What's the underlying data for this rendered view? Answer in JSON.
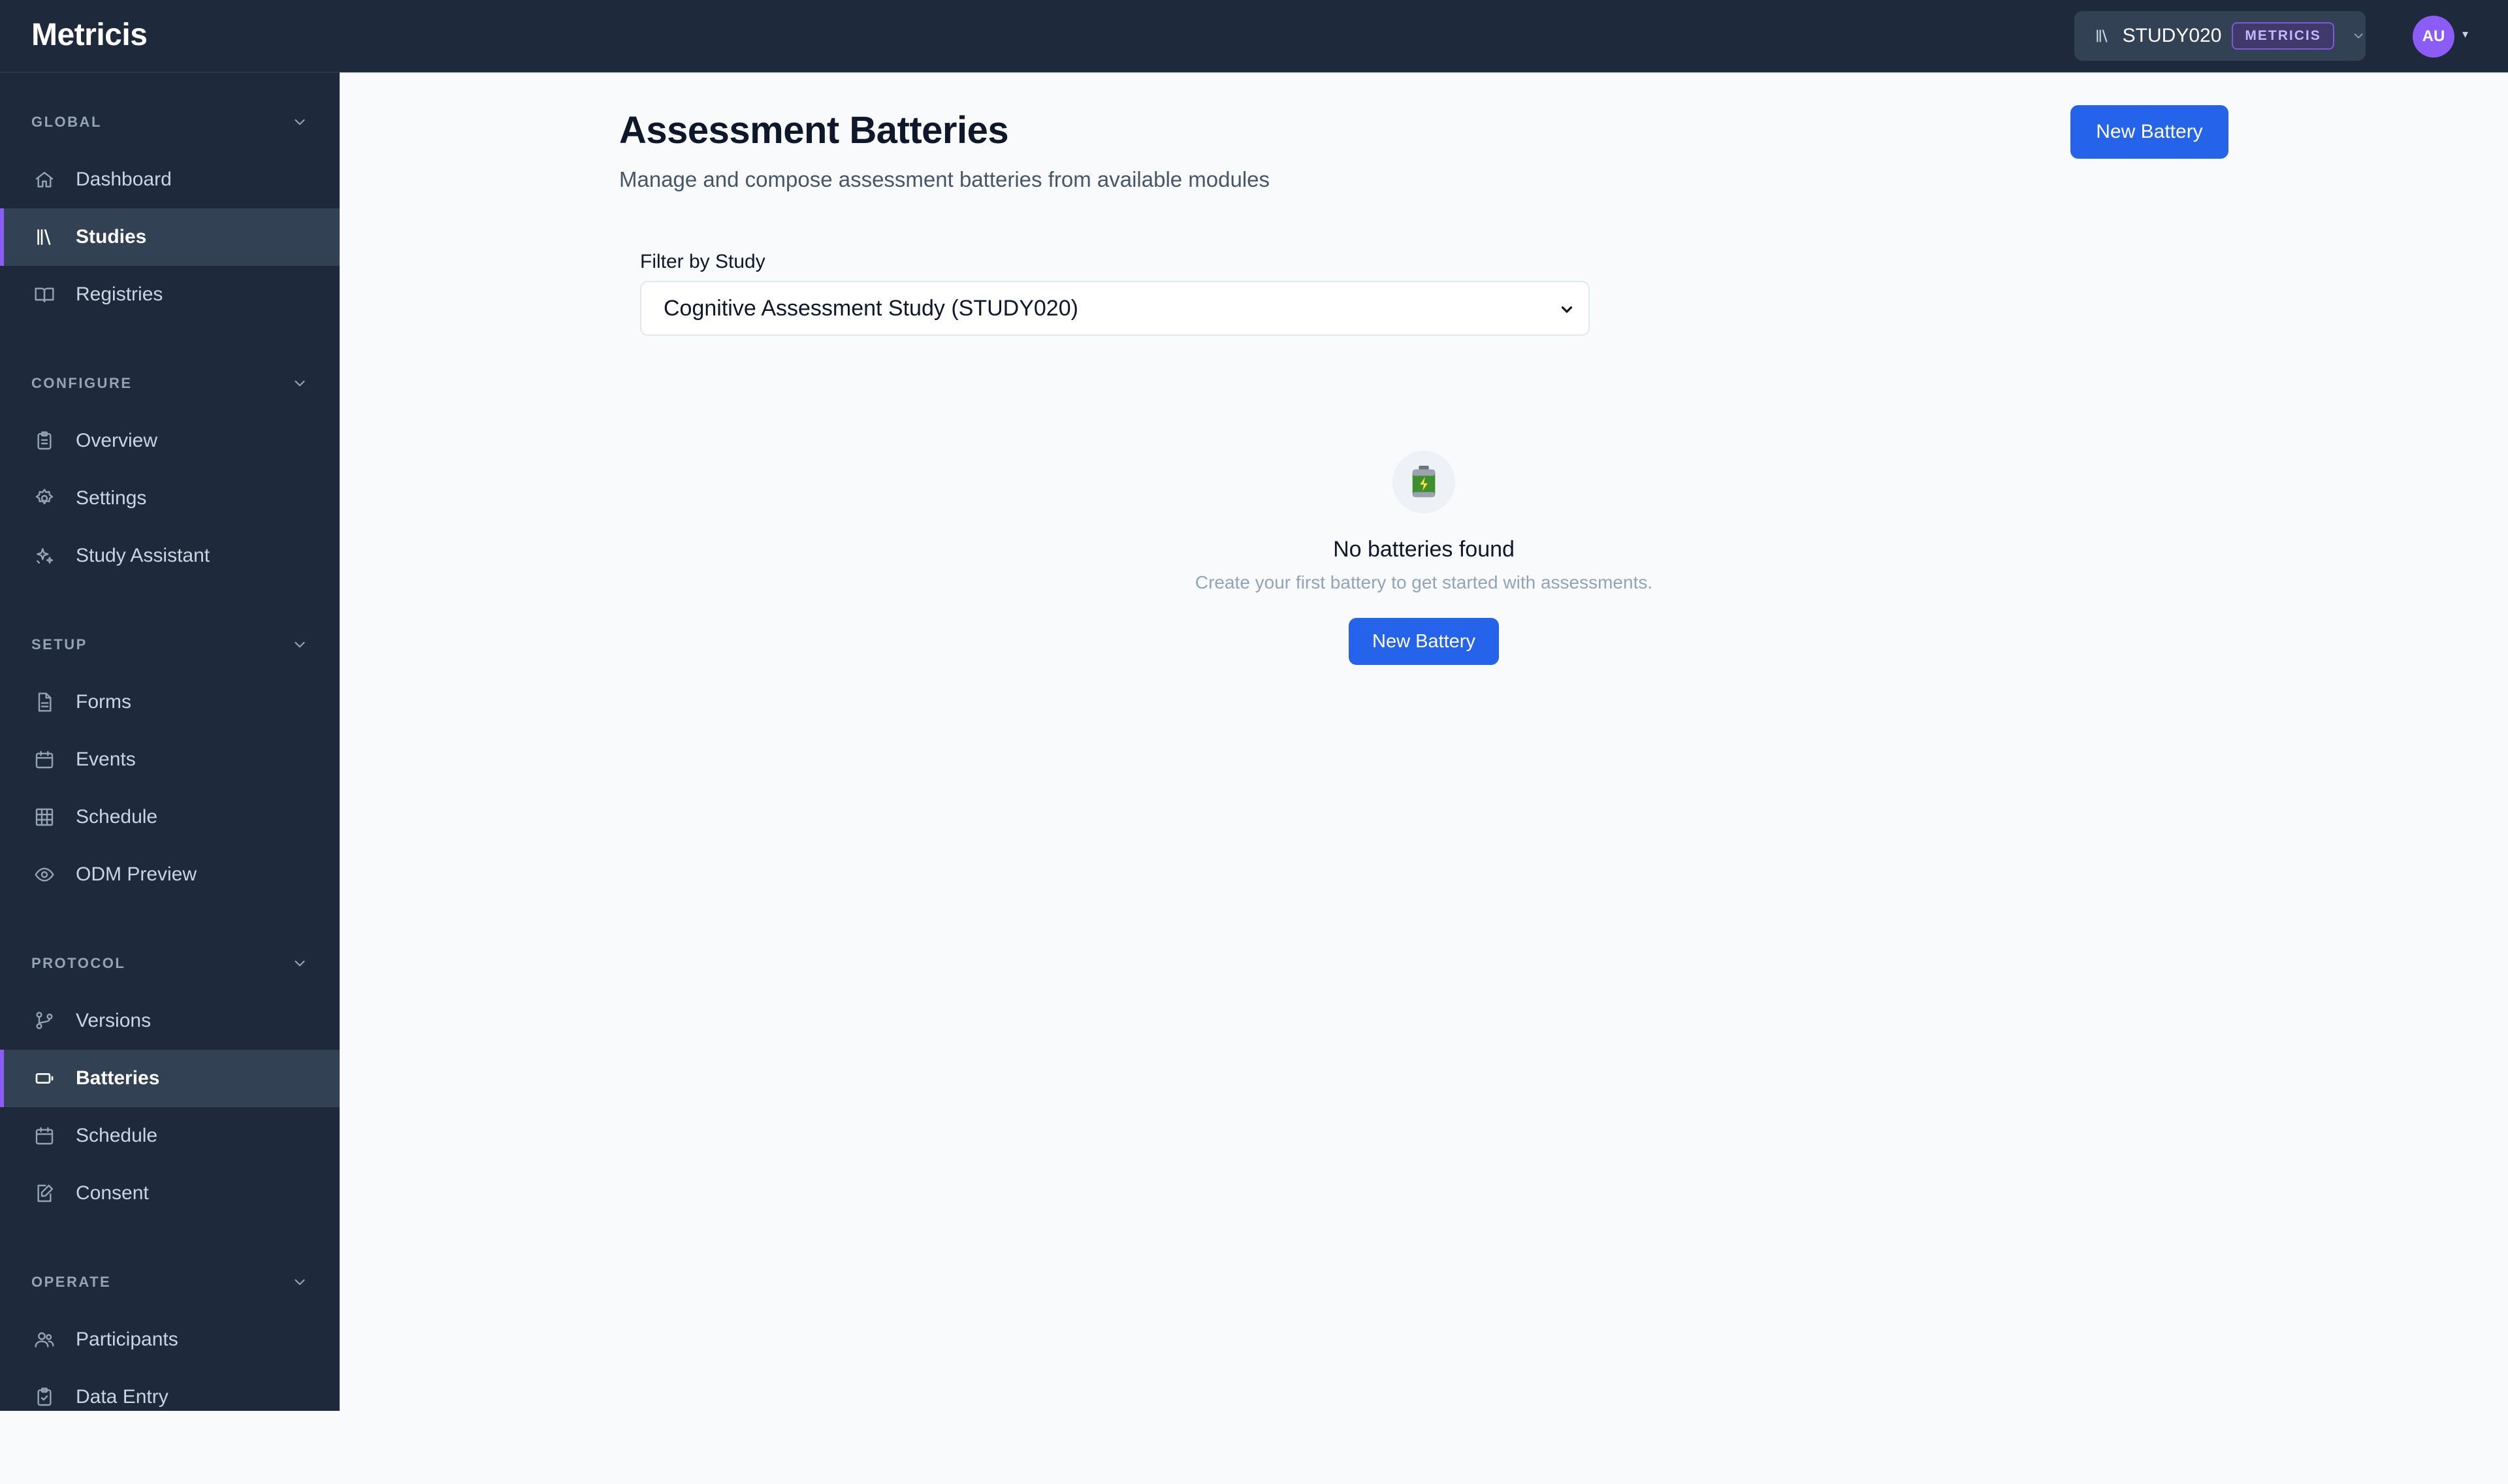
{
  "app": {
    "brand": "Metricis"
  },
  "topbar": {
    "study_code": "STUDY020",
    "study_badge": "METRICIS",
    "avatar_initials": "AU",
    "avatar_caret": "▾"
  },
  "sidebar": {
    "sections": [
      {
        "label": "GLOBAL",
        "items": [
          {
            "label": "Dashboard",
            "icon": "home-icon"
          },
          {
            "label": "Studies",
            "icon": "library-icon",
            "active": true
          },
          {
            "label": "Registries",
            "icon": "book-open-icon"
          }
        ]
      },
      {
        "label": "CONFIGURE",
        "items": [
          {
            "label": "Overview",
            "icon": "clipboard-icon"
          },
          {
            "label": "Settings",
            "icon": "gear-icon"
          },
          {
            "label": "Study Assistant",
            "icon": "sparkles-icon"
          }
        ]
      },
      {
        "label": "SETUP",
        "items": [
          {
            "label": "Forms",
            "icon": "document-icon"
          },
          {
            "label": "Events",
            "icon": "calendar-icon"
          },
          {
            "label": "Schedule",
            "icon": "grid-icon"
          },
          {
            "label": "ODM Preview",
            "icon": "eye-icon"
          }
        ]
      },
      {
        "label": "PROTOCOL",
        "items": [
          {
            "label": "Versions",
            "icon": "git-branch-icon"
          },
          {
            "label": "Batteries",
            "icon": "battery-icon",
            "active": true
          },
          {
            "label": "Schedule",
            "icon": "calendar-icon"
          },
          {
            "label": "Consent",
            "icon": "edit-document-icon"
          }
        ]
      },
      {
        "label": "OPERATE",
        "items": [
          {
            "label": "Participants",
            "icon": "users-icon"
          },
          {
            "label": "Data Entry",
            "icon": "clipboard-check-icon"
          }
        ]
      }
    ]
  },
  "main": {
    "title": "Assessment Batteries",
    "subtitle": "Manage and compose assessment batteries from available modules",
    "new_battery_label": "New Battery",
    "filter": {
      "label": "Filter by Study",
      "selected": "Cognitive Assessment Study (STUDY020)"
    },
    "empty_state": {
      "icon": "battery-emoji-icon",
      "title": "No batteries found",
      "description": "Create your first battery to get started with assessments.",
      "button_label": "New Battery"
    }
  },
  "colors": {
    "sidebar_bg": "#1e293b",
    "accent": "#8b5cf6",
    "primary": "#2563eb",
    "page_bg": "#f8fafc"
  }
}
